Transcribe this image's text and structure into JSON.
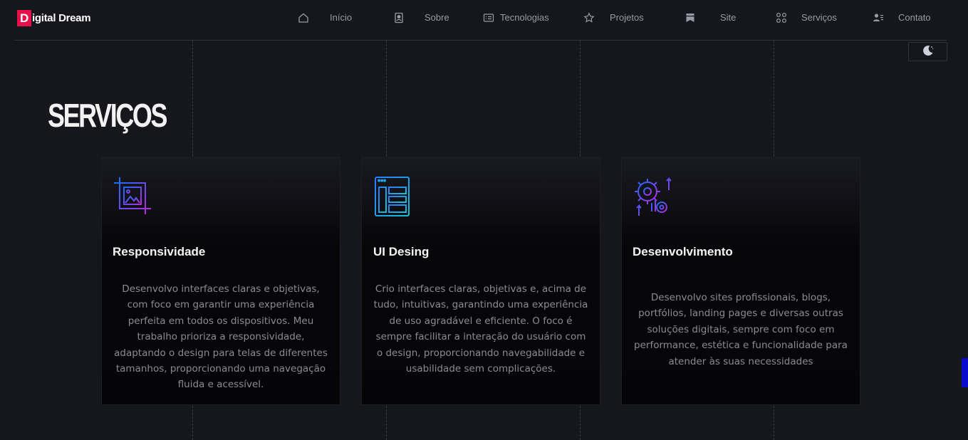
{
  "brand": {
    "letter": "D",
    "rest": "igital Dream"
  },
  "nav": [
    {
      "label": "Início",
      "icon": "home-icon"
    },
    {
      "label": "Sobre",
      "icon": "profile-icon"
    },
    {
      "label": "Tecnologias",
      "icon": "list-icon"
    },
    {
      "label": "Projetos",
      "icon": "star-icon"
    },
    {
      "label": "Site",
      "icon": "bookmark-icon"
    },
    {
      "label": "Serviços",
      "icon": "grid-icon"
    },
    {
      "label": "Contato",
      "icon": "contact-icon"
    }
  ],
  "theme_toggle": {
    "icon": "moon-icon"
  },
  "section": {
    "title": "SERVIÇOS"
  },
  "cards": [
    {
      "icon": "responsive-crop-icon",
      "title": "Responsividade",
      "text": "Desenvolvo interfaces claras e objetivas, com foco em garantir uma experiência perfeita em todos os dispositivos. Meu trabalho prioriza a responsividade, adaptando o design para telas de diferentes tamanhos, proporcionando uma navegação fluida e acessível."
    },
    {
      "icon": "ui-layout-icon",
      "title": "UI Desing",
      "text": "Crio interfaces claras, objetivas e, acima de tudo, intuitivas, garantindo uma experiência de uso agradável e eficiente. O foco é sempre facilitar a interação do usuário com o design, proporcionando navegabilidade e usabilidade sem complicações."
    },
    {
      "icon": "development-gears-icon",
      "title": "Desenvolvimento",
      "text": "Desenvolvo sites profissionais, blogs, portfólios, landing pages e diversas outras soluções digitais, sempre com foco em performance, estética e funcionalidade para atender às suas necessidades"
    }
  ],
  "colors": {
    "background": "#16161d",
    "brand": "#e8104a",
    "icon_gradient_start": "#1a6cff",
    "icon_gradient_end": "#b02ee0"
  }
}
